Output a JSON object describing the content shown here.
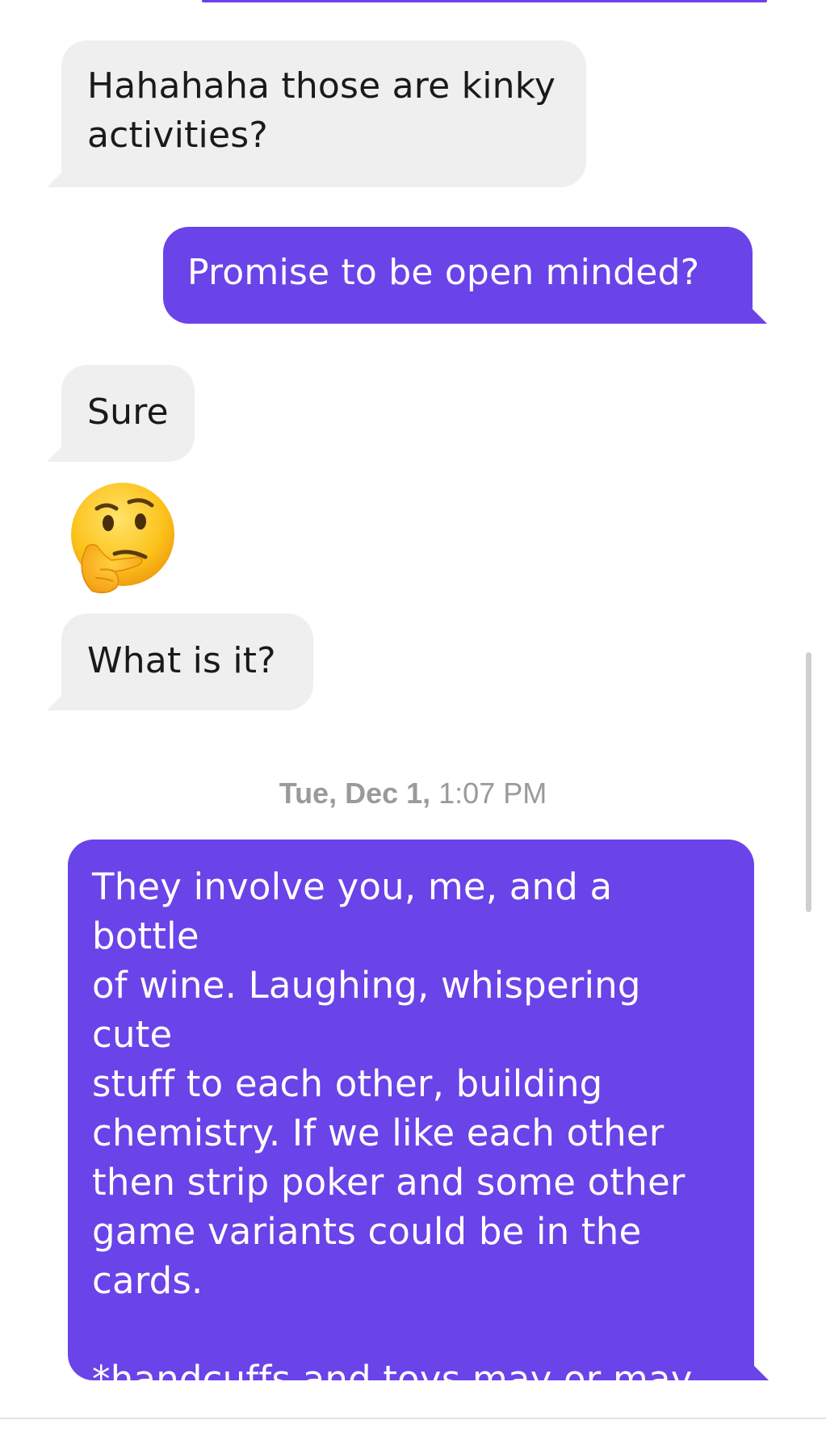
{
  "messages": [
    {
      "direction": "incoming",
      "text": "Hahahaha those are kinky\nactivities?"
    },
    {
      "direction": "outgoing",
      "text": "Promise to be open minded?"
    },
    {
      "direction": "incoming",
      "text": "Sure"
    },
    {
      "direction": "incoming",
      "type": "emoji",
      "emoji": "thinking-face"
    },
    {
      "direction": "incoming",
      "text": "What is it?"
    },
    {
      "direction": "outgoing",
      "text": "They involve you, me, and a bottle\nof wine. Laughing, whispering cute\nstuff to each other, building\nchemistry. If we like each other\nthen strip poker and some other\ngame variants could be in the\ncards.\n\n*handcuffs and toys may or may\nnot be included*"
    }
  ],
  "timestamp": {
    "day": "Tue, Dec 1,",
    "time": " 1:07 PM"
  },
  "colors": {
    "outgoing_bubble": "#6a43e9",
    "incoming_bubble": "#efefef",
    "timestamp_text": "#9a9a9a"
  }
}
